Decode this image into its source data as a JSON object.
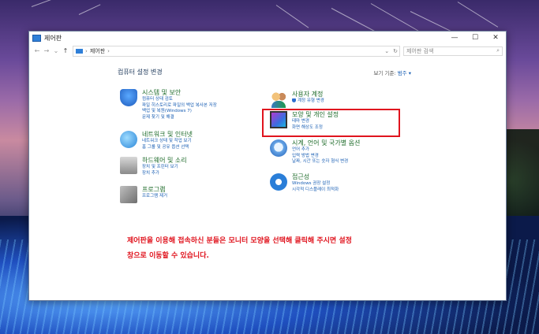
{
  "window": {
    "title": "제어판",
    "controls": {
      "minimize": "—",
      "maximize": "☐",
      "close": "✕"
    }
  },
  "address": {
    "back": "←",
    "forward": "→",
    "up": "↑",
    "separator": "›",
    "path": "제어판",
    "trail": "›",
    "dropdown": "⌄",
    "refresh": "↻",
    "search_placeholder": "제어판 검색",
    "search_icon": "⌕"
  },
  "main": {
    "heading": "컴퓨터 설정 변경",
    "view_by_label": "보기 기준:",
    "view_by_value": "범주 ▾",
    "left": [
      {
        "icon": "security-shield-icon",
        "title": "시스템 및 보안",
        "links": [
          "컴퓨터 상태 검토",
          "파일 히스토리로 파일의 백업 복사본 저장",
          "백업 및 복원(Windows 7)",
          "문제 찾기 및 해결"
        ]
      },
      {
        "icon": "network-globe-icon",
        "title": "네트워크 및 인터넷",
        "links": [
          "네트워크 상태 및 작업 보기",
          "홈 그룹 및 공유 옵션 선택"
        ]
      },
      {
        "icon": "printer-icon",
        "title": "하드웨어 및 소리",
        "links": [
          "장치 및 프린터 보기",
          "장치 추가"
        ]
      },
      {
        "icon": "programs-box-icon",
        "title": "프로그램",
        "links": [
          "프로그램 제거"
        ]
      }
    ],
    "right": [
      {
        "icon": "users-icon",
        "title": "사용자 계정",
        "links": [
          "계정 유형 변경"
        ]
      },
      {
        "icon": "monitor-palette-icon",
        "title": "모양 및 개인 설정",
        "links": [
          "테마 변경",
          "화면 해상도 조정"
        ]
      },
      {
        "icon": "clock-globe-icon",
        "title": "시계, 언어 및 국가별 옵션",
        "links": [
          "언어 추가",
          "입력 방법 변경",
          "날짜, 시간 또는 숫자 형식 변경"
        ]
      },
      {
        "icon": "ease-of-access-icon",
        "title": "접근성",
        "links": [
          "Windows 권장 설정",
          "시각적 디스플레이 최적화"
        ]
      }
    ]
  },
  "annotation": {
    "line1": "제어판을 이용해 접속하신 분들은 모니터 모양을 선택해 클릭해 주시면 설정",
    "line2": "창으로 이동할 수 있습니다.",
    "color": "#e0141e"
  },
  "colors": {
    "accent": "#1a5fb4",
    "category_title": "#1e6b2a",
    "highlight": "#e0141e"
  }
}
